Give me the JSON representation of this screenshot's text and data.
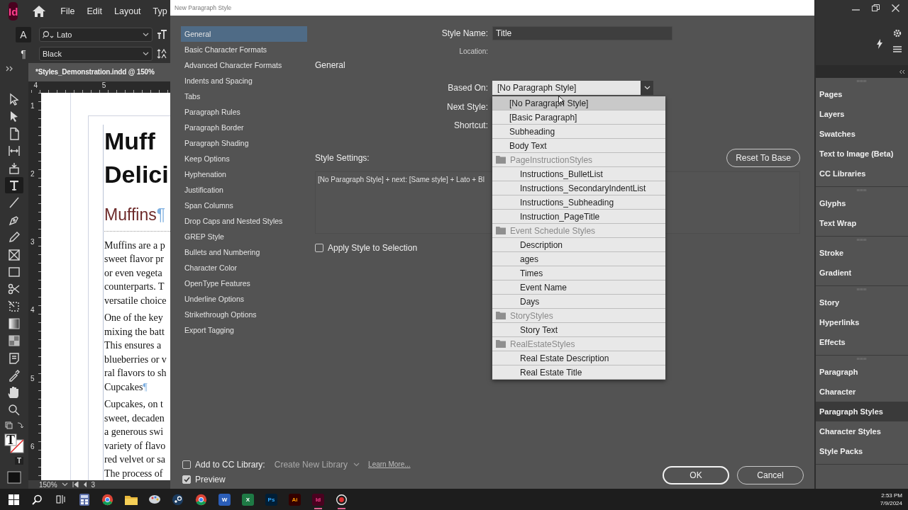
{
  "app_menu": {
    "logo": "Id",
    "items": [
      "File",
      "Edit",
      "Layout",
      "Typ"
    ]
  },
  "control_bar": {
    "character_mode": "A",
    "paragraph_mode": "¶",
    "font_field": "Lato",
    "style_field": "Black"
  },
  "document": {
    "tab": "*Styles_Demonstration.indd @ 150%",
    "ruler_h": [
      "4",
      "5"
    ],
    "ruler_v": [
      "1",
      "2",
      "3",
      "4",
      "5",
      "6"
    ],
    "blocks": [
      {
        "kind": "title",
        "lines": [
          "Muff",
          "Delici"
        ]
      },
      {
        "kind": "heading",
        "text": "Muffins",
        "mark": "¶"
      },
      {
        "kind": "body",
        "lines": [
          "Muffins are a p",
          "sweet flavor pr",
          "or even vegeta",
          "counterparts. T",
          "versatile choice"
        ]
      },
      {
        "kind": "body",
        "lines": [
          "One of the key",
          "mixing the batt",
          "This ensures a",
          "blueberries or v",
          "ral flavors to sh"
        ]
      },
      {
        "kind": "inline_heading",
        "text": "Cupcakes",
        "mark": "¶"
      },
      {
        "kind": "body",
        "lines": [
          "Cupcakes, on t",
          "sweet, decaden",
          "a generous swi",
          "variety of flavo",
          "red velvet or sa",
          "The process of"
        ]
      }
    ],
    "zoom": "150%",
    "page": "3"
  },
  "tools": [
    {
      "kind": "selection",
      "selected": false
    },
    {
      "kind": "direct",
      "selected": false
    },
    {
      "kind": "page",
      "selected": false
    },
    {
      "kind": "gap",
      "selected": false
    },
    {
      "kind": "collector",
      "selected": false
    },
    {
      "kind": "type",
      "selected": true
    },
    {
      "kind": "line",
      "selected": false
    },
    {
      "kind": "pen",
      "selected": false
    },
    {
      "kind": "pencil",
      "selected": false
    },
    {
      "kind": "frame",
      "selected": false
    },
    {
      "kind": "rectangle",
      "selected": false
    },
    {
      "kind": "scissors",
      "selected": false
    },
    {
      "kind": "transform",
      "selected": false
    },
    {
      "kind": "gradient",
      "selected": false
    },
    {
      "kind": "feather",
      "selected": false
    },
    {
      "kind": "note",
      "selected": false
    },
    {
      "kind": "eyedropper",
      "selected": false
    },
    {
      "kind": "hand",
      "selected": false
    },
    {
      "kind": "zoom",
      "selected": false
    }
  ],
  "fill_stroke": {
    "glyph": "T",
    "format_glyph": "T"
  },
  "dialog": {
    "title": "New Paragraph Style",
    "categories": [
      {
        "label": "General",
        "selected": true
      },
      {
        "label": "Basic Character Formats",
        "selected": false
      },
      {
        "label": "Advanced Character Formats",
        "selected": false
      },
      {
        "label": "Indents and Spacing",
        "selected": false
      },
      {
        "label": "Tabs",
        "selected": false
      },
      {
        "label": "Paragraph Rules",
        "selected": false
      },
      {
        "label": "Paragraph Border",
        "selected": false
      },
      {
        "label": "Paragraph Shading",
        "selected": false
      },
      {
        "label": "Keep Options",
        "selected": false
      },
      {
        "label": "Hyphenation",
        "selected": false
      },
      {
        "label": "Justification",
        "selected": false
      },
      {
        "label": "Span Columns",
        "selected": false
      },
      {
        "label": "Drop Caps and Nested Styles",
        "selected": false
      },
      {
        "label": "GREP Style",
        "selected": false
      },
      {
        "label": "Bullets and Numbering",
        "selected": false
      },
      {
        "label": "Character Color",
        "selected": false
      },
      {
        "label": "OpenType Features",
        "selected": false
      },
      {
        "label": "Underline Options",
        "selected": false
      },
      {
        "label": "Strikethrough Options",
        "selected": false
      },
      {
        "label": "Export Tagging",
        "selected": false
      }
    ],
    "style_name": {
      "label": "Style Name:",
      "value": "Title"
    },
    "location_label": "Location:",
    "section": "General",
    "based_on": {
      "label": "Based On:",
      "value": "[No Paragraph Style]",
      "expanded": true,
      "options": [
        {
          "kind": "style",
          "label": "[No Paragraph Style]",
          "selected": true
        },
        {
          "kind": "style",
          "label": "[Basic Paragraph]",
          "selected": false
        },
        {
          "kind": "style",
          "label": "Subheading",
          "selected": false
        },
        {
          "kind": "style",
          "label": "Body Text",
          "selected": false
        },
        {
          "kind": "group",
          "label": "PageInstructionStyles",
          "children": [
            {
              "kind": "style",
              "label": "Instructions_BulletList",
              "selected": false
            },
            {
              "kind": "style",
              "label": "Instructions_SecondaryIndentList",
              "selected": false
            },
            {
              "kind": "style",
              "label": "Instructions_Subheading",
              "selected": false
            },
            {
              "kind": "style",
              "label": "Instruction_PageTitle",
              "selected": false
            }
          ]
        },
        {
          "kind": "group",
          "label": "Event Schedule Styles",
          "children": [
            {
              "kind": "style",
              "label": "Description",
              "selected": false
            },
            {
              "kind": "style",
              "label": "ages",
              "selected": false
            },
            {
              "kind": "style",
              "label": "Times",
              "selected": false
            },
            {
              "kind": "style",
              "label": "Event Name",
              "selected": false
            },
            {
              "kind": "style",
              "label": "Days",
              "selected": false
            }
          ]
        },
        {
          "kind": "group",
          "label": "StoryStyles",
          "children": [
            {
              "kind": "style",
              "label": "Story Text",
              "selected": false
            }
          ]
        },
        {
          "kind": "group",
          "label": "RealEstateStyles",
          "children": [
            {
              "kind": "style",
              "label": "Real Estate Description",
              "selected": false
            },
            {
              "kind": "style",
              "label": "Real Estate Title",
              "selected": false
            }
          ]
        }
      ]
    },
    "next_style_label": "Next Style:",
    "shortcut_label": "Shortcut:",
    "style_settings": {
      "label": "Style Settings:",
      "text": "[No Paragraph Style] + next: [Same style] + Lato + Bl",
      "reset_button": "Reset To Base"
    },
    "apply_style": {
      "label": "Apply Style to Selection",
      "checked": false
    },
    "cc_library": {
      "label": "Add to CC Library:",
      "checked": false,
      "library": "Create New Library",
      "link": "Learn More..."
    },
    "preview": {
      "label": "Preview",
      "checked": true
    },
    "buttons": [
      {
        "label": "OK",
        "default": true
      },
      {
        "label": "Cancel",
        "default": false
      }
    ]
  },
  "right_panel": {
    "groups": [
      {
        "items": [
          {
            "label": "Pages",
            "selected": false
          },
          {
            "label": "Layers",
            "selected": false
          },
          {
            "label": "Swatches",
            "selected": false
          },
          {
            "label": "Text to Image (Beta)",
            "selected": false
          },
          {
            "label": "CC Libraries",
            "selected": false
          }
        ]
      },
      {
        "items": [
          {
            "label": "Glyphs",
            "selected": false
          },
          {
            "label": "Text Wrap",
            "selected": false
          }
        ]
      },
      {
        "items": [
          {
            "label": "Stroke",
            "selected": false
          },
          {
            "label": "Gradient",
            "selected": false
          }
        ]
      },
      {
        "items": [
          {
            "label": "Story",
            "selected": false
          },
          {
            "label": "Hyperlinks",
            "selected": false
          },
          {
            "label": "Effects",
            "selected": false
          }
        ]
      },
      {
        "items": [
          {
            "label": "Paragraph",
            "selected": false
          },
          {
            "label": "Character",
            "selected": false
          },
          {
            "label": "Paragraph Styles",
            "selected": true
          },
          {
            "label": "Character Styles",
            "selected": false
          },
          {
            "label": "Style Packs",
            "selected": false
          }
        ]
      }
    ]
  },
  "taskbar": {
    "apps": [
      {
        "kind": "calculator",
        "active": false
      },
      {
        "kind": "chrome",
        "active": false
      },
      {
        "kind": "folder",
        "active": false
      },
      {
        "kind": "paint",
        "active": false
      },
      {
        "kind": "steam",
        "active": false
      },
      {
        "kind": "chrome",
        "active": false
      },
      {
        "kind": "word",
        "label": "W",
        "active": false
      },
      {
        "kind": "excel",
        "label": "X",
        "active": false
      },
      {
        "kind": "photoshop",
        "label": "Ps",
        "active": false
      },
      {
        "kind": "illustrator",
        "label": "Ai",
        "active": false
      },
      {
        "kind": "indesign",
        "label": "Id",
        "active": true
      },
      {
        "kind": "capture",
        "active": true
      }
    ],
    "time": "2:53 PM",
    "date": "7/9/2024"
  }
}
